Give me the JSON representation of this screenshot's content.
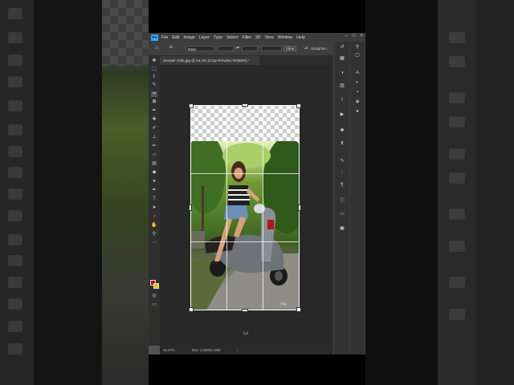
{
  "app": {
    "name": "Adobe Photoshop",
    "logo_text": "Ps",
    "menu": [
      "File",
      "Edit",
      "Image",
      "Layer",
      "Type",
      "Select",
      "Filter",
      "3D",
      "View",
      "Window",
      "Help"
    ]
  },
  "options_bar": {
    "ratio_select": "Ratio",
    "clear_label": "Clear",
    "straighten_label": "Straighten"
  },
  "document": {
    "tab_title": "Scooter Girls.jpg @ 44.4% (Crop Preview, RGB/8#) *",
    "canvas_label": "fyd"
  },
  "status": {
    "zoom": "44.37%",
    "doc_size": "Doc: 1.22M/1.22M"
  },
  "colors": {
    "foreground": "#c00000",
    "background": "#f5c400",
    "accent": "#31a8ff"
  },
  "icons": {
    "tools": [
      "move-icon",
      "marquee-icon",
      "lasso-icon",
      "quick-select-icon",
      "crop-icon",
      "frame-icon",
      "eyedropper-icon",
      "healing-icon",
      "brush-icon",
      "stamp-icon",
      "history-brush-icon",
      "eraser-icon",
      "gradient-icon",
      "blur-icon",
      "dodge-icon",
      "pen-icon",
      "type-icon",
      "path-select-icon",
      "shape-icon",
      "hand-icon",
      "zoom-icon",
      "more-icon"
    ],
    "panels": [
      "history-icon",
      "properties-icon",
      "color-icon",
      "swatches-icon",
      "adjustments-icon",
      "libraries-icon",
      "layers-icon",
      "channels-icon",
      "paths-icon"
    ]
  }
}
